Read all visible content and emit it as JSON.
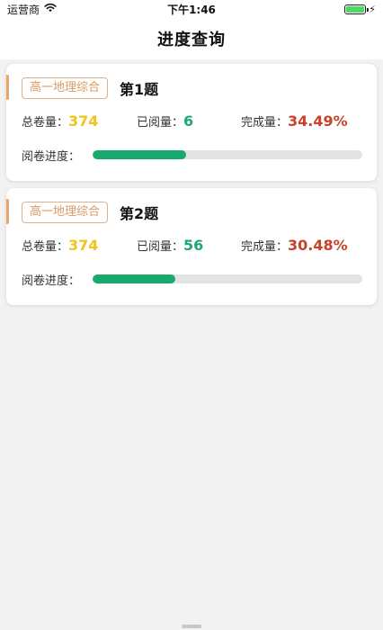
{
  "status_bar": {
    "carrier": "运营商",
    "time": "下午1:46",
    "icons": [
      "wifi-icon",
      "battery-icon",
      "charging-bolt-icon"
    ]
  },
  "nav": {
    "title": "进度查询"
  },
  "labels": {
    "total": "总卷量：",
    "read": "已阅量：",
    "rate": "完成量：",
    "progress": "阅卷进度："
  },
  "cards": [
    {
      "subject": "高一地理综合",
      "title": "第1题",
      "total": "374",
      "read": "6",
      "rate": "34.49%",
      "progress_fraction": 0.345
    },
    {
      "subject": "高一地理综合",
      "title": "第2题",
      "total": "374",
      "read": "56",
      "rate": "30.48%",
      "progress_fraction": 0.305
    }
  ],
  "colors": {
    "accent_orange": "#e8a66a",
    "total_yellow": "#f0c419",
    "read_green": "#22a57a",
    "rate_red": "#c9412b",
    "progress_green": "#18a96e"
  }
}
